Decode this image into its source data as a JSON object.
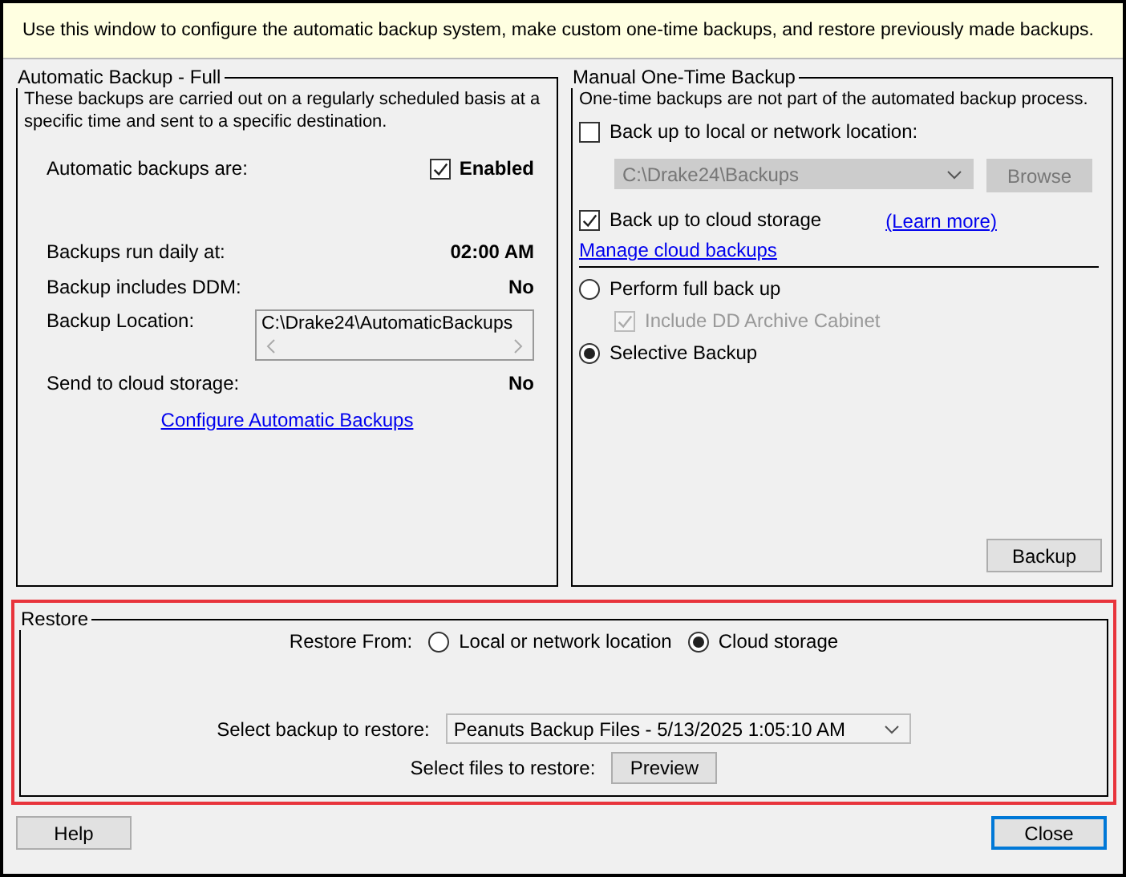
{
  "banner": {
    "text": "Use this window to configure the automatic backup system, make custom one-time backups, and restore previously made backups."
  },
  "automatic": {
    "title": "Automatic Backup - Full",
    "description": "These backups are carried out on a regularly scheduled basis at a specific time and sent to a specific destination.",
    "rows": [
      {
        "kind": "checkbox",
        "label": "Automatic backups are:",
        "value": "Enabled",
        "checked": true
      },
      {
        "kind": "value",
        "label": "Backups run daily at:",
        "value": "02:00 AM"
      },
      {
        "kind": "value",
        "label": "Backup includes DDM:",
        "value": "No"
      },
      {
        "kind": "path",
        "label": "Backup Location:",
        "value": "C:\\Drake24\\AutomaticBackups"
      },
      {
        "kind": "value",
        "label": "Send to cloud storage:",
        "value": "No"
      }
    ],
    "link": "Configure Automatic Backups"
  },
  "manual": {
    "title": "Manual One-Time Backup",
    "description": "One-time backups are not part of the automated backup process.",
    "local": {
      "label": "Back up to local or network location:",
      "checked": false,
      "path": "C:\\Drake24\\Backups",
      "browse": "Browse",
      "disabled": true
    },
    "cloud": {
      "label": "Back up to cloud storage",
      "checked": true,
      "learn_more": "(Learn more)",
      "manage": "Manage cloud backups"
    },
    "modes": [
      {
        "label": "Perform full back up",
        "selected": false,
        "sub": {
          "label": "Include DD Archive Cabinet",
          "checked": true,
          "disabled": true
        }
      },
      {
        "label": "Selective Backup",
        "selected": true
      }
    ],
    "button": "Backup"
  },
  "restore": {
    "title": "Restore",
    "highlighted": true,
    "from_label": "Restore From:",
    "sources": [
      {
        "label": "Local or network location",
        "selected": false
      },
      {
        "label": "Cloud storage",
        "selected": true
      }
    ],
    "select_label": "Select backup to restore:",
    "select_value": "Peanuts Backup Files - 5/13/2025 1:05:10 AM",
    "files_label": "Select files to restore:",
    "preview": "Preview"
  },
  "buttons": [
    {
      "label": "Help",
      "default": false
    },
    {
      "label": "Close",
      "default": true
    }
  ]
}
